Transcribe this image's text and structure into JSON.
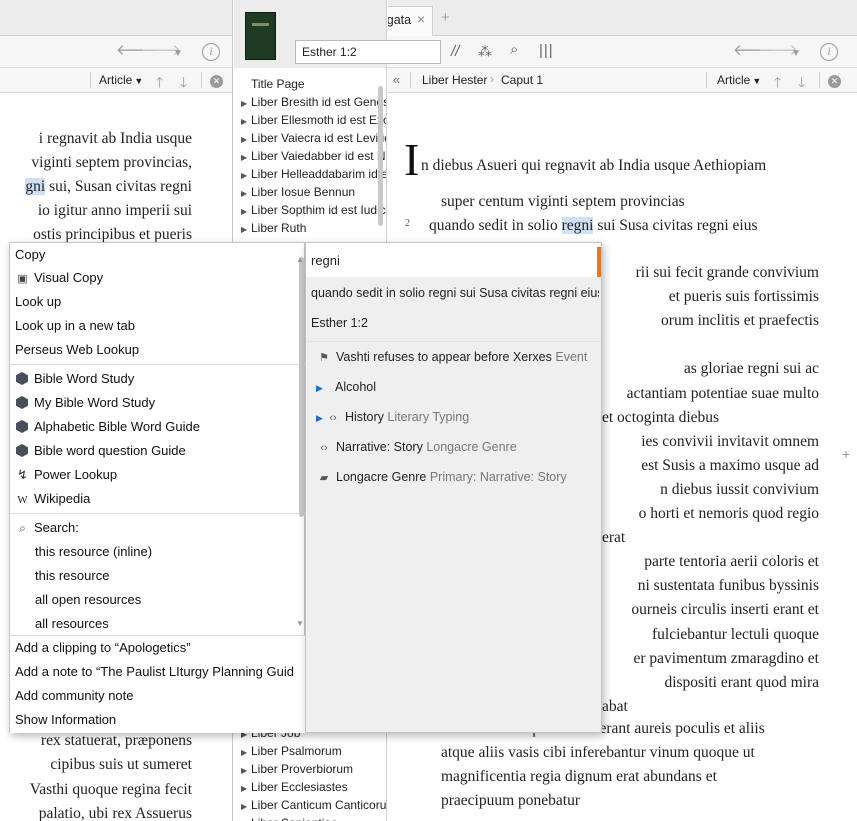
{
  "left_panel": {
    "nav": {
      "article_label": "Article"
    },
    "text_lines": [
      "i regnavit ab India usque",
      "viginti septem provincias,",
      "gni sui, Susan civitas regni",
      "io igitur anno imperii sui",
      "ostis principibus et pueris",
      "",
      "",
      "",
      "",
      "",
      "",
      "",
      "",
      "",
      "",
      "",
      "",
      "",
      "",
      "",
      "",
      "",
      "",
      "",
      "",
      "rex statuerat, præponens",
      "cipibus suis ut sumeret",
      "Vasthi quoque regina fecit",
      "palatio, ubi rex Assuerus"
    ],
    "highlight_word": "gni"
  },
  "toc": {
    "items_top": [
      {
        "label": "Title Page",
        "expandable": false
      },
      {
        "label": "Liber Bresith id est Genesis",
        "expandable": true
      },
      {
        "label": "Liber Ellesmoth id est Exodus",
        "expandable": true
      },
      {
        "label": "Liber Vaiecra id est Leviticus",
        "expandable": true
      },
      {
        "label": "Liber Vaiedabber id est Numeri",
        "expandable": true
      },
      {
        "label": "Liber Helleaddabarim id est Deuteronomium",
        "expandable": true
      },
      {
        "label": "Liber Iosue Bennun",
        "expandable": true
      },
      {
        "label": "Liber Sopthim id est Iudicum",
        "expandable": true
      },
      {
        "label": "Liber Ruth",
        "expandable": true
      }
    ],
    "items_bottom": [
      {
        "label": "Liber Job",
        "expandable": true
      },
      {
        "label": "Liber Psalmorum",
        "expandable": true
      },
      {
        "label": "Liber Proverbiorum",
        "expandable": true
      },
      {
        "label": "Liber Ecclesiastes",
        "expandable": true
      },
      {
        "label": "Liber Canticum Canticorum",
        "expandable": true
      },
      {
        "label": "Liber Sapientiae",
        "expandable": true
      }
    ]
  },
  "right_panel": {
    "tab_title": "Biblia Sacra Vulgata",
    "reference_input": "Esther 1:2",
    "breadcrumb": [
      "Liber Hester",
      "Caput 1"
    ],
    "nav": {
      "article_label": "Article"
    },
    "text": {
      "dropcap": "I",
      "line1": "n diebus Asueri qui regnavit ab India usque Aethiopiam",
      "line2": "super centum viginti septem provincias",
      "verse2_num": "2",
      "verse2_pre": "quando sedit in solio ",
      "verse2_word": "regni",
      "verse2_post": " sui Susa civitas regni eius",
      "fragments": [
        "rii sui fecit grande convivium",
        "et pueris suis fortissimis",
        "orum inclitis et praefectis",
        "",
        "as gloriae regni sui ac",
        "actantiam potentiae suae multo",
        "et octoginta diebus",
        "ies convivii invitavit omnem",
        "est Susis a maximo usque ad",
        "n diebus iussit convivium",
        "o horti et nemoris quod regio",
        "erat",
        "parte tentoria aerii coloris et",
        "ni sustentata funibus byssinis",
        "ourneis circulis inserti erant et",
        "fulciebantur lectuli quoque",
        "er pavimentum zmaragdino et",
        "dispositi erant quod mira",
        "abat"
      ],
      "bottom_lines": [
        "bibebant autem qui invitati erant aureis poculis et aliis",
        "atque aliis vasis cibi inferebantur vinum quoque ut",
        "magnificentia regia dignum erat abundans et",
        "praecipuum ponebatur"
      ]
    }
  },
  "context_menu": {
    "group1": [
      "Copy",
      "Visual Copy",
      "Look up",
      "Look up in a new tab",
      "Perseus Web Lookup"
    ],
    "group2": [
      "Bible Word Study",
      "My Bible Word Study",
      "Alphabetic Bible Word Guide",
      "Bible word question Guide",
      "Power Lookup",
      "Wikipedia"
    ],
    "search_label": "Search:",
    "search_items": [
      "this resource (inline)",
      "this resource",
      "all open resources",
      "all resources"
    ],
    "bottom": [
      "Add a clipping to “Apologetics”",
      "Add a note to “The Paulist LIturgy Planning Guid",
      "Add community note",
      "Show Information"
    ]
  },
  "info_popup": {
    "word": "regni",
    "context": "quando sedit in solio regni sui Susa civitas regni eius",
    "reference": "Esther 1:2",
    "items": [
      {
        "icon": "flag-icon",
        "label": "Vashti refuses to appear before Xerxes",
        "meta": "Event",
        "expandable": false
      },
      {
        "icon": "",
        "label": "Alcohol",
        "meta": "",
        "expandable": true
      },
      {
        "icon": "code-brackets-icon",
        "label": "History",
        "meta": "Literary Typing",
        "expandable": true
      },
      {
        "icon": "code-brackets-icon",
        "label": "Narrative: Story",
        "meta": "Longacre Genre",
        "expandable": false
      },
      {
        "icon": "tag-icon",
        "label": "Longacre Genre",
        "meta": "Primary: Narrative: Story",
        "expandable": false
      }
    ]
  },
  "colors": {
    "highlight": "#cfe0f4",
    "accent_orange": "#e87722",
    "toolbar_bg": "#f6f6f6",
    "tabstrip_bg": "#ececec"
  }
}
